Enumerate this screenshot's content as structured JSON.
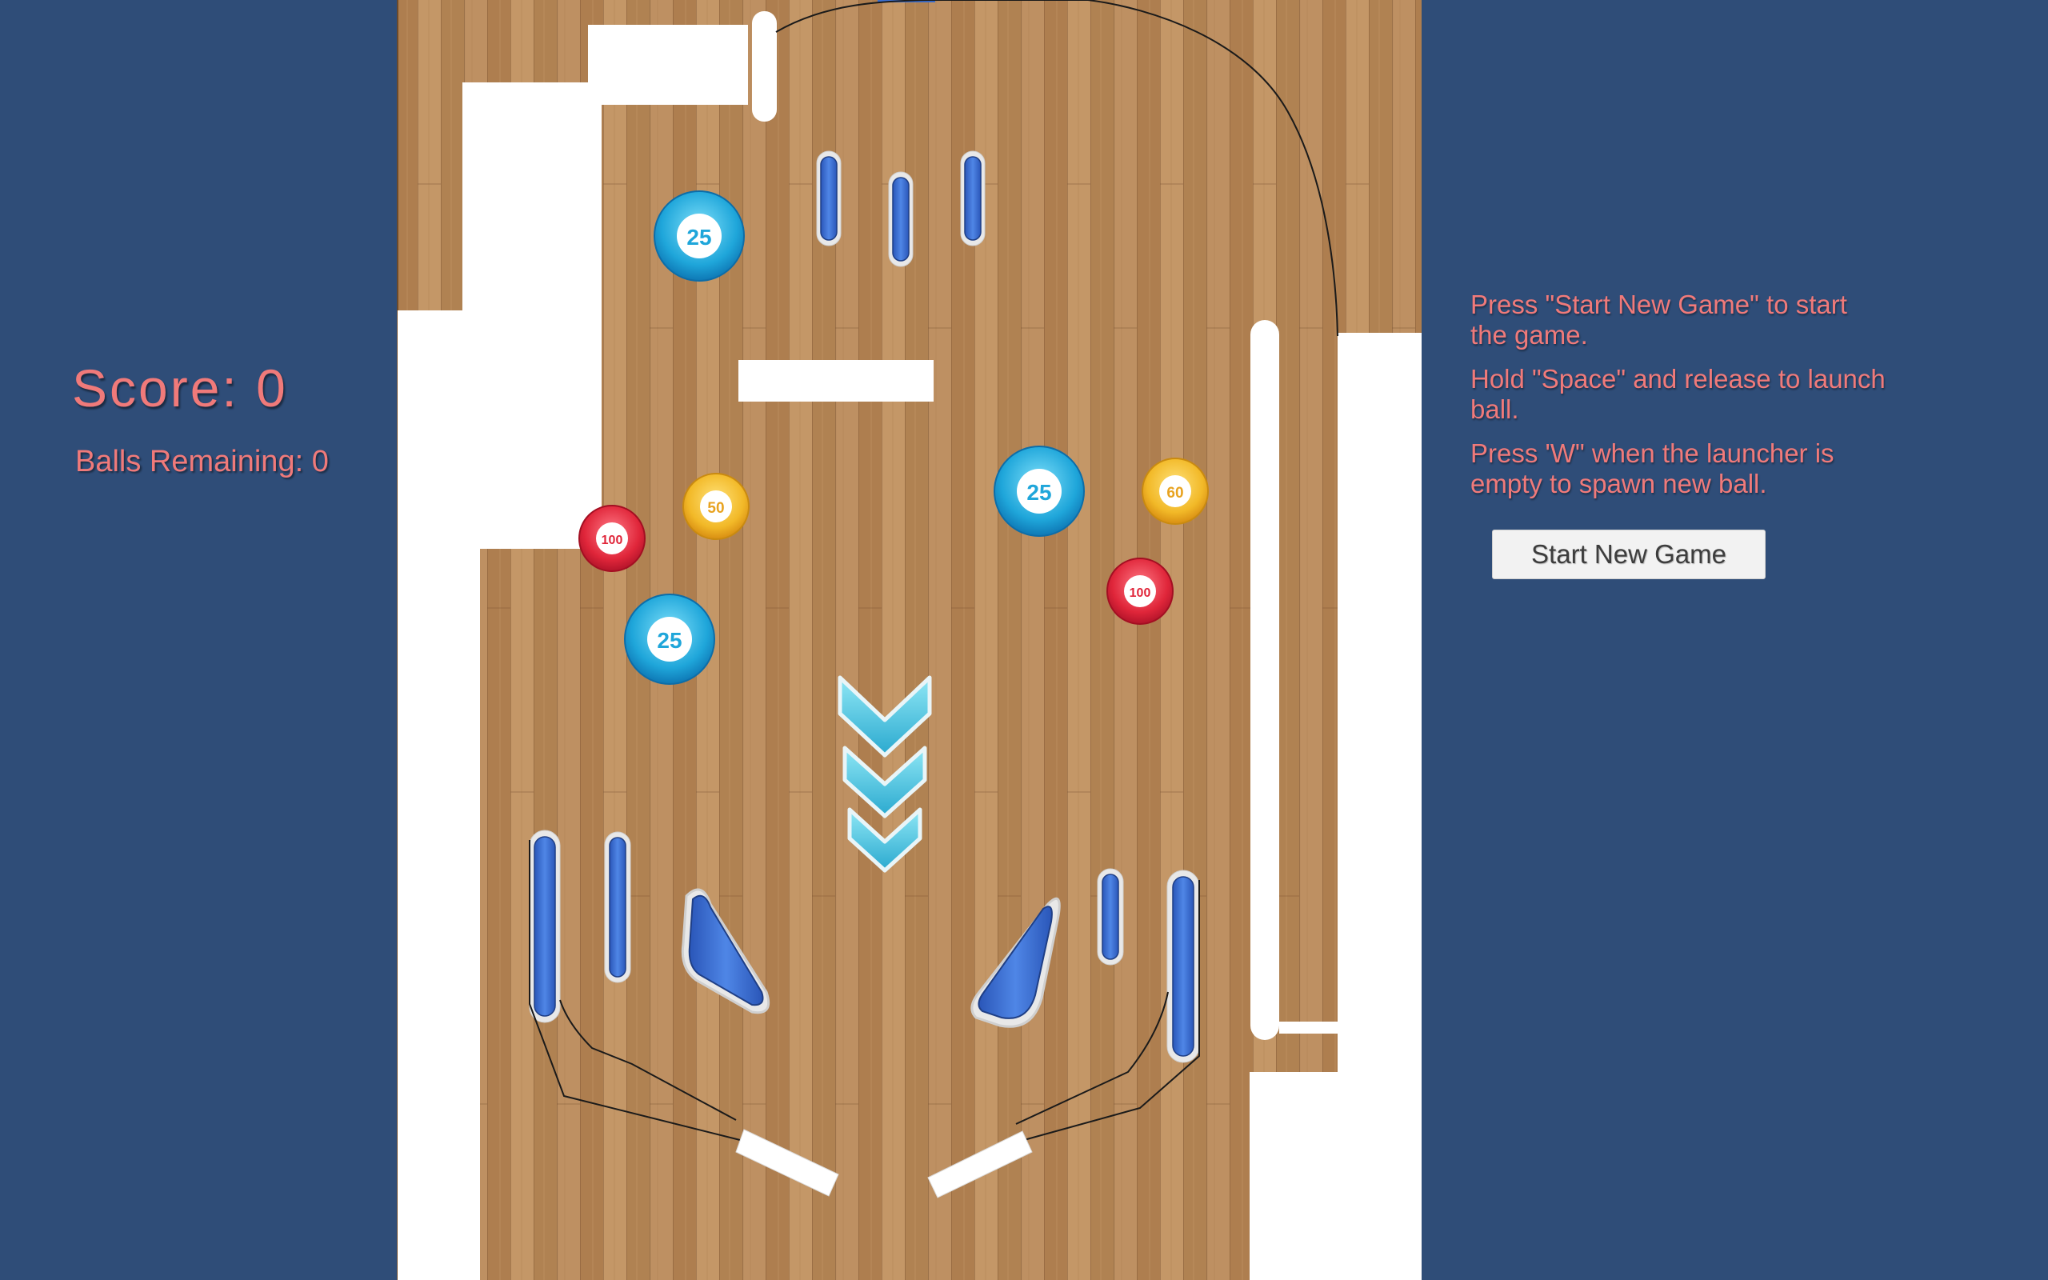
{
  "hud": {
    "score_label": "Score: 0",
    "balls_label": "Balls Remaining: 0"
  },
  "instructions": [
    "Press \"Start New Game\" to start the game.",
    "Hold \"Space\" and release to launch ball.",
    "Press 'W\" when the launcher is empty to spawn new ball."
  ],
  "start_button_label": "Start New Game",
  "bumpers": {
    "bumper_25_label": "25",
    "bumper_50_label": "50",
    "bumper_60_label": "60",
    "bumper_100_label": "100"
  },
  "colors": {
    "background": "#2F4D78",
    "text_accent": "#F07A7A",
    "wood": "#B58657",
    "bumper_blue": "#1FA6DA",
    "bumper_yellow": "#F2B928",
    "bumper_red": "#E0263A",
    "post_blue": "#3B6FD0",
    "chevron": "#5CCFE6"
  }
}
